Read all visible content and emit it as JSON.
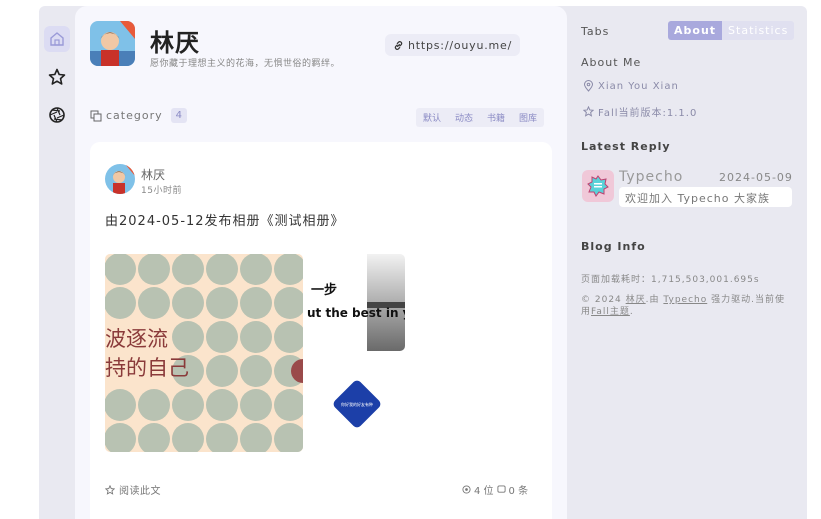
{
  "site": {
    "name": "林厌",
    "description": "愿你藏于理想主义的花海，无惧世俗的羁绊。",
    "url": "https://ouyu.me/"
  },
  "rail": [
    {
      "icon": "home-icon"
    },
    {
      "icon": "star-icon"
    },
    {
      "icon": "aperture-icon"
    }
  ],
  "category": {
    "label": "category",
    "count": "4",
    "tabs": [
      "默认",
      "动态",
      "书籍",
      "图库"
    ]
  },
  "post": {
    "author": "林厌",
    "time": "15小时前",
    "text": "由2024-05-12发布相册《测试相册》",
    "read_more": "阅读此文",
    "views": "4 位",
    "comments": "0 条",
    "img1_lines": [
      "波逐流",
      "持的自己"
    ],
    "img2_lines": [
      "一步",
      "ut the best in y"
    ],
    "img3_text": "你好我的好友有种"
  },
  "sidebar": {
    "tabs_label": "Tabs",
    "tab_about": "About",
    "tab_statistics": "Statistics",
    "about_me": "About Me",
    "location": "Xian You Xian",
    "version": "Fall当前版本:1.1.0",
    "latest_reply": "Latest Reply",
    "reply_name": "Typecho",
    "reply_date": "2024-05-09",
    "reply_text": "欢迎加入 Typecho 大家族",
    "blog_info": "Blog Info",
    "load_time": "页面加载耗时：1,715,503,001.695s",
    "copyright_prefix": "© 2024 ",
    "copyright_author": "林厌",
    "copyright_mid": ".由 ",
    "copyright_engine": "Typecho",
    "copyright_mid2": " 强力驱动.当前使用",
    "copyright_theme": "Fall主题",
    "copyright_end": "."
  },
  "colors": {
    "accent": "#a9a9dd",
    "frame": "#e9e9f1",
    "panel": "#f7f7fd"
  }
}
